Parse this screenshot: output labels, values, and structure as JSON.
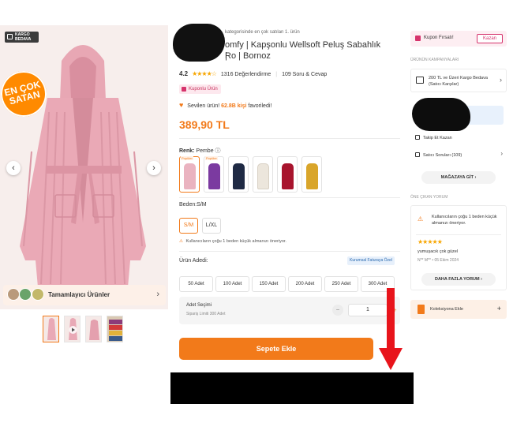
{
  "gallery": {
    "cargo_badge": "KARGO BEDAVA",
    "best_seller_line1": "EN ÇOK",
    "best_seller_line2": "SATAN",
    "prev_arrow": "‹",
    "next_arrow": "›",
    "complementary_label": "Tamamlayıcı Ürünler",
    "complementary_chevron": "›"
  },
  "product": {
    "bestseller_line": "kategorisinde en çok satılan 1. ürün",
    "title_line1": "omfy | Kapşonlu Wellsoft Peluş Sabahlık |",
    "title_line2": "Ro | Bornoz",
    "rating_score": "4.2",
    "rating_stars": "★★★★☆",
    "rating_count": "1316 Değerlendirme",
    "questions": "109 Soru & Cevap",
    "coupon_tag": "Kuponlu Ürün",
    "favorite_prefix": "Sevilen ürün!",
    "favorite_count": "62.8B kişi",
    "favorite_suffix": "favoriledi!",
    "price": "389,90 TL",
    "color_label": "Renk:",
    "color_value": "Pembe",
    "color_info": "ⓘ",
    "popular_tag": "Popüler",
    "size_label": "Beden:",
    "size_value": "S/M",
    "sizes": [
      "S/M",
      "L/XL"
    ],
    "size_note": "Kullanıcıların çoğu 1 beden küçük almanızı öneriyor.",
    "size_note_icon": "⚠",
    "qty_label": "Ürün Adedi:",
    "invoice_tag": "Kurumsal Faturaya Özel",
    "qty_options": [
      "50 Adet",
      "100 Adet",
      "150 Adet",
      "200 Adet",
      "250 Adet",
      "300 Adet"
    ],
    "qty_box_title": "Adet Seçimi",
    "qty_box_sub": "Sipariş Limiti 300 Adet",
    "qty_minus": "−",
    "qty_value": "1",
    "qty_plus": "+",
    "add_to_cart": "Sepete Ekle"
  },
  "sidebar": {
    "coupon_text": "Kupon Fırsatı!",
    "coupon_btn": "Kazan",
    "campaign_title": "ÜRÜNÜN KAMPANYALARI",
    "campaign_text": "200 TL ve Üzeri Kargo Bedava (Satıcı Karşılar)",
    "campaign_chevron": "›",
    "seller_follow": "Takip Et Kazan",
    "seller_questions": "Satıcı Soruları (109)",
    "seller_chevron": "›",
    "store_btn": "MAĞAZAYA GİT",
    "store_chevron": "›",
    "review_title": "ÖNE ÇIKAN YORUM",
    "review_warn_icon": "⚠",
    "review_note": "Kullanıcıların çoğu 1 beden küçük almanızı öneriyor.",
    "review_stars": "★★★★★",
    "review_text": "yumuşacık çok güzel",
    "review_meta": "N** M** • 05 Ekim 2024",
    "more_reviews": "DAHA FAZLA YORUM",
    "more_chevron": "›",
    "collection_text": "Koleksiyona Ekle",
    "collection_plus": "+"
  },
  "colors": {
    "accent": "#f27a1a",
    "robe_pink": "#e9a9b6",
    "arrow_red": "#e8141b",
    "swatch_colors": [
      "#eab3c0",
      "#7b3aa0",
      "#1f2a44",
      "#ece6dc",
      "#a8142d",
      "#d9a52a"
    ]
  }
}
